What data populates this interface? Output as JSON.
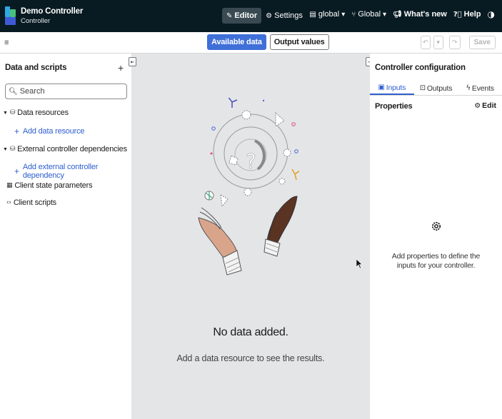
{
  "header": {
    "app_title": "Demo Controller",
    "app_subtitle": "Controller",
    "mode_tabs": [
      {
        "label": "Editor",
        "icon": "pencil-icon",
        "active": true
      },
      {
        "label": "Settings",
        "icon": "gear-icon",
        "active": false
      }
    ],
    "right_items": [
      {
        "label": "global",
        "icon": "book-icon",
        "dropdown": true
      },
      {
        "label": "Global",
        "icon": "branch-icon",
        "dropdown": true
      },
      {
        "label": "What's new",
        "icon": "megaphone-icon",
        "dropdown": false
      },
      {
        "label": "Help",
        "icon": "help-circle-icon",
        "dropdown": false
      }
    ],
    "theme_icon": "contrast-icon"
  },
  "toolbar": {
    "available_data_label": "Available data",
    "output_values_label": "Output values",
    "save_label": "Save"
  },
  "left_panel": {
    "title": "Data and scripts",
    "search_placeholder": "Search",
    "sections": [
      {
        "label": "Data resources",
        "add_label": "Add data resource"
      },
      {
        "label": "External controller dependencies",
        "add_label": "Add external controller dependency"
      }
    ],
    "client_state_label": "Client state parameters",
    "client_scripts_label": "Client scripts"
  },
  "canvas": {
    "empty_title": "No data added.",
    "empty_subtitle": "Add a data resource to see the results."
  },
  "right_panel": {
    "title": "Controller configuration",
    "tabs": [
      {
        "label": "Inputs",
        "active": true
      },
      {
        "label": "Outputs",
        "active": false
      },
      {
        "label": "Events",
        "active": false
      }
    ],
    "properties_label": "Properties",
    "edit_label": "Edit",
    "empty_message": "Add properties to define the inputs for your controller."
  },
  "colors": {
    "header_bg": "#091b22",
    "primary": "#3f6fd8",
    "link": "#2f5fd0",
    "canvas_bg": "#e4e5e7"
  }
}
